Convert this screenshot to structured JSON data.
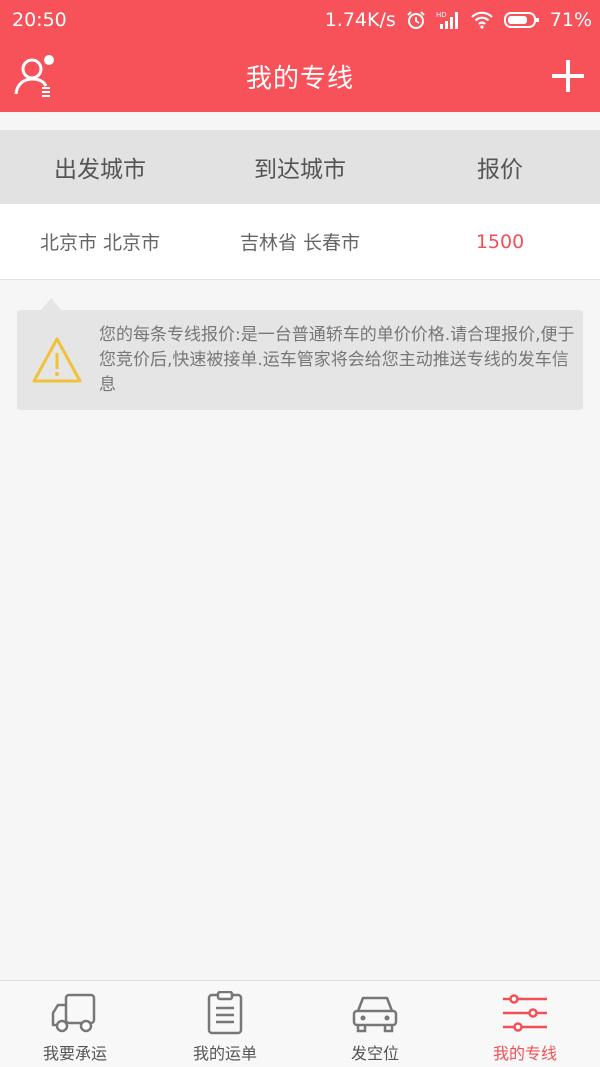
{
  "status_bar": {
    "time": "20:50",
    "network_speed": "1.74K/s",
    "battery_percent": "71%",
    "icons": [
      "alarm-icon",
      "hd-signal-icon",
      "wifi-icon",
      "battery-icon"
    ]
  },
  "toolbar": {
    "title": "我的专线",
    "left_icon": "user-profile-icon",
    "right_icon": "plus-icon"
  },
  "table": {
    "headers": [
      "出发城市",
      "到达城市",
      "报价"
    ],
    "rows": [
      {
        "from": "北京市 北京市",
        "to": "吉林省 长春市",
        "price": "1500"
      }
    ]
  },
  "tip": {
    "icon": "warning-icon",
    "text": "您的每条专线报价:是一台普通轿车的单价价格.请合理报价,便于您竞价后,快速被接单.运车管家将会给您主动推送专线的发车信息"
  },
  "bottom_nav": {
    "tabs": [
      {
        "label": "我要承运",
        "icon": "truck-icon"
      },
      {
        "label": "我的运单",
        "icon": "clipboard-icon"
      },
      {
        "label": "发空位",
        "icon": "car-icon"
      },
      {
        "label": "我的专线",
        "icon": "route-lines-icon"
      }
    ],
    "active_index": 3
  },
  "colors": {
    "primary": "#f7525a",
    "price_text": "#f25057",
    "header_bg": "#e2e2e2",
    "warning_icon": "#f0c23a"
  }
}
